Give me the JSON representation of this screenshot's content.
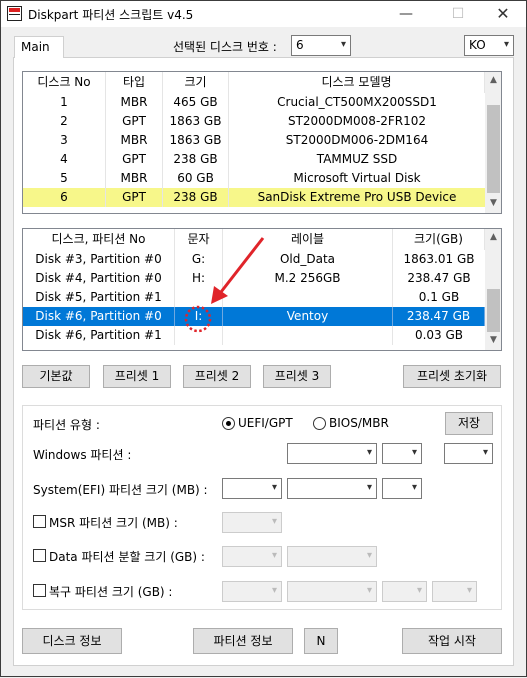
{
  "window": {
    "title": "Diskpart 파티션 스크립트 v4.5",
    "minimize_glyph": "—",
    "maximize_glyph": "☐",
    "close_glyph": "✕"
  },
  "tabs": [
    {
      "label": "Main"
    }
  ],
  "disk_select": {
    "label": "선택된 디스크 번호 :",
    "value": "6"
  },
  "lang_select": {
    "value": "KO"
  },
  "disk_table": {
    "columns": [
      "디스크 No",
      "타입",
      "크기",
      "디스크 모델명"
    ],
    "rows": [
      [
        "1",
        "MBR",
        "465 GB",
        "Crucial_CT500MX200SSD1"
      ],
      [
        "2",
        "GPT",
        "1863 GB",
        "ST2000DM008-2FR102"
      ],
      [
        "3",
        "MBR",
        "1863 GB",
        "ST2000DM006-2DM164"
      ],
      [
        "4",
        "GPT",
        "238 GB",
        "TAMMUZ SSD"
      ],
      [
        "5",
        "MBR",
        "60 GB",
        "Microsoft Virtual Disk"
      ],
      [
        "6",
        "GPT",
        "238 GB",
        "SanDisk Extreme Pro USB Device"
      ]
    ],
    "highlighted_row": 5
  },
  "partition_table": {
    "columns": [
      "디스크, 파티션 No",
      "문자",
      "레이블",
      "크기(GB)"
    ],
    "rows": [
      [
        "Disk #3, Partition #0",
        "G:",
        "Old_Data",
        "1863.01 GB"
      ],
      [
        "Disk #4, Partition #0",
        "H:",
        "M.2 256GB",
        "238.47 GB"
      ],
      [
        "Disk #5, Partition #1",
        "",
        "",
        "0.1 GB"
      ],
      [
        "Disk #6, Partition #0",
        "I:",
        "Ventoy",
        "238.47 GB"
      ],
      [
        "Disk #6, Partition #1",
        "",
        "",
        "0.03 GB"
      ]
    ],
    "selected_row": 3
  },
  "preset_buttons": {
    "default": "기본값",
    "preset1": "프리셋 1",
    "preset2": "프리셋 2",
    "preset3": "프리셋 3",
    "reset": "프리셋 초기화"
  },
  "options": {
    "partition_type_label": "파티션 유형 :",
    "uefi_label": "UEFI/GPT",
    "bios_label": "BIOS/MBR",
    "uefi_selected": true,
    "save_label": "저장",
    "windows_partition_label": "Windows 파티션 :",
    "efi_size_label": "System(EFI) 파티션 크기 (MB) :",
    "msr_label": "MSR 파티션 크기 (MB) :",
    "data_split_label": "Data 파티션 분할 크기 (GB) :",
    "recovery_label": "복구 파티션 크기 (GB) :"
  },
  "bottom_buttons": {
    "disk_info": "디스크 정보",
    "partition_info": "파티션 정보",
    "n": "N",
    "start": "작업 시작"
  },
  "colors": {
    "selection": "#0078d7",
    "highlight_yellow": "#f7f78a",
    "annotation_red": "#e0242a"
  },
  "icons": {
    "dropdown": "▾",
    "scroll_up": "▲",
    "scroll_down": "▼"
  }
}
